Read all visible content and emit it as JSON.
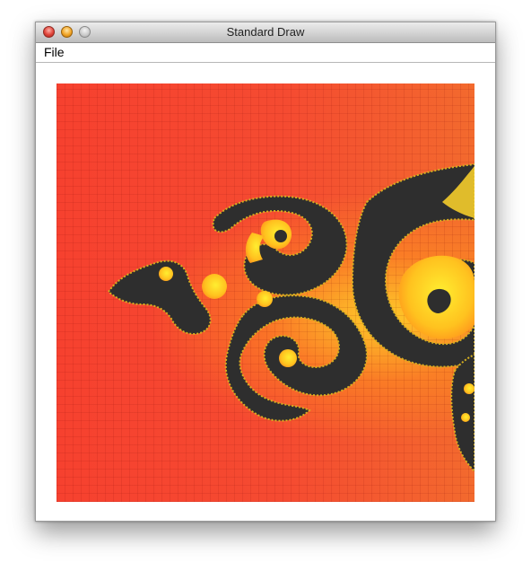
{
  "window": {
    "title": "Standard Draw"
  },
  "menu": {
    "items": [
      "File"
    ]
  },
  "icons": {
    "close": "close-button-red",
    "minimize": "minimize-button-yellow",
    "zoom": "zoom-button-gray"
  },
  "colors": {
    "background_red": "#f5432f",
    "fractal_dark": "#2e2e2e",
    "fractal_yellow": "#ffe31a",
    "fractal_orange": "#ffa020"
  }
}
